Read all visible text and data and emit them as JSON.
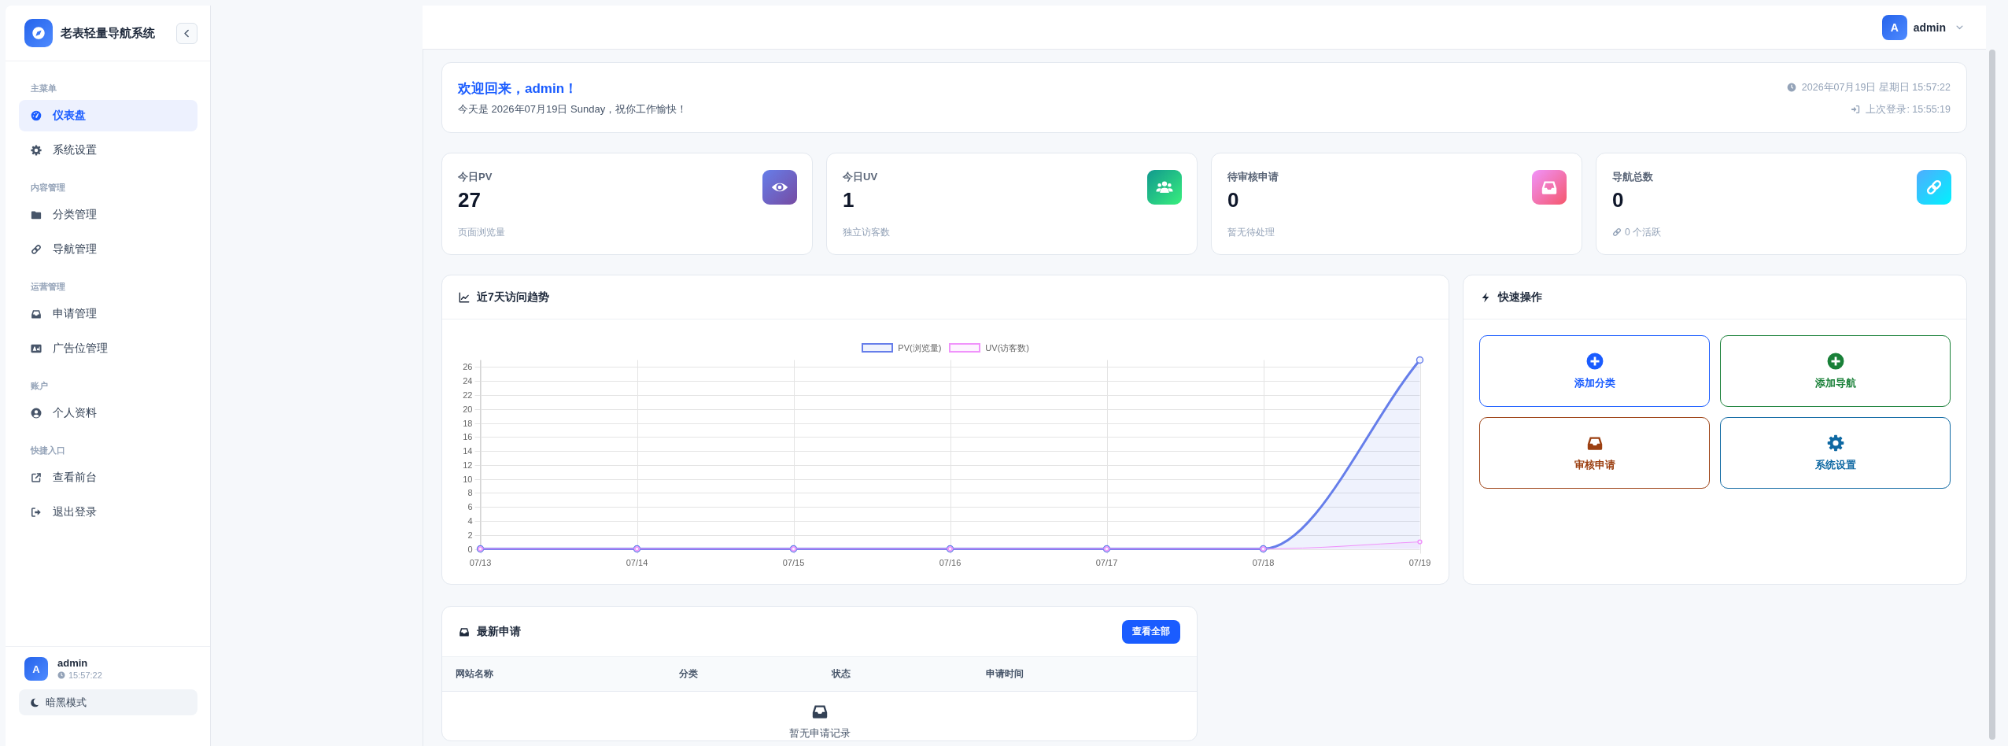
{
  "sidebar": {
    "brand": {
      "title": "老表轻量导航系统"
    },
    "sections": [
      {
        "heading": "主菜单",
        "items": [
          {
            "label": "仪表盘",
            "kind": "dashboard",
            "selected": true
          },
          {
            "label": "系统设置",
            "kind": "settings",
            "selected": false
          }
        ]
      },
      {
        "heading": "内容管理",
        "items": [
          {
            "label": "分类管理",
            "kind": "categories",
            "selected": false
          },
          {
            "label": "导航管理",
            "kind": "links",
            "selected": false
          }
        ]
      },
      {
        "heading": "运营管理",
        "items": [
          {
            "label": "申请管理",
            "kind": "applications",
            "selected": false
          },
          {
            "label": "广告位管理",
            "kind": "ads",
            "selected": false
          }
        ]
      },
      {
        "heading": "账户",
        "items": [
          {
            "label": "个人资料",
            "kind": "profile",
            "selected": false
          }
        ]
      },
      {
        "heading": "快捷入口",
        "items": [
          {
            "label": "查看前台",
            "kind": "frontend",
            "selected": false
          },
          {
            "label": "退出登录",
            "kind": "logout",
            "selected": false
          }
        ]
      }
    ],
    "user": {
      "avatar": "A",
      "name": "admin",
      "time": "15:57:22"
    },
    "theme_toggle": {
      "label": "暗黑模式"
    }
  },
  "header": {
    "user": {
      "avatar": "A",
      "name": "admin"
    }
  },
  "welcome": {
    "title": "欢迎回来，admin！",
    "subtitle": "今天是 2026年07月19日 Sunday，祝你工作愉快！",
    "datetime": "2026年07月19日 星期日 15:57:22",
    "last_login": "上次登录: 15:55:19"
  },
  "stats": [
    {
      "kind": "pv",
      "label": "今日PV",
      "value": "27",
      "note": "页面浏览量"
    },
    {
      "kind": "uv",
      "label": "今日UV",
      "value": "1",
      "note": "独立访客数"
    },
    {
      "kind": "pending",
      "label": "待审核申请",
      "value": "0",
      "note": "暂无待处理"
    },
    {
      "kind": "links",
      "label": "导航总数",
      "value": "0",
      "note": "0 个活跃"
    }
  ],
  "trend": {
    "title": "近7天访问趋势",
    "chart_data": {
      "type": "area",
      "categories": [
        "07/13",
        "07/14",
        "07/15",
        "07/16",
        "07/17",
        "07/18",
        "07/19"
      ],
      "series": [
        {
          "name": "PV(浏览量)",
          "color": "#667eea",
          "values": [
            0,
            0,
            0,
            0,
            0,
            0,
            27
          ]
        },
        {
          "name": "UV(访客数)",
          "color": "#f093fb",
          "values": [
            0,
            0,
            0,
            0,
            0,
            0,
            1
          ]
        }
      ],
      "ylim": [
        0,
        27
      ],
      "yticks": [
        0,
        2,
        4,
        6,
        8,
        10,
        12,
        14,
        16,
        18,
        20,
        22,
        24,
        26
      ],
      "grid": true,
      "legend": "top"
    }
  },
  "quick_actions": {
    "title": "快速操作",
    "items": [
      {
        "kind": "add",
        "label": "添加分类",
        "color": "#1a5cff"
      },
      {
        "kind": "add",
        "label": "添加导航",
        "color": "#198038"
      },
      {
        "kind": "review",
        "label": "审核申请",
        "color": "#9c4012"
      },
      {
        "kind": "settings",
        "label": "系统设置",
        "color": "#0f69a3"
      }
    ]
  },
  "latest": {
    "title": "最新申请",
    "button": "查看全部",
    "columns": [
      "网站名称",
      "分类",
      "状态",
      "申请时间"
    ],
    "empty": "暂无申请记录"
  }
}
